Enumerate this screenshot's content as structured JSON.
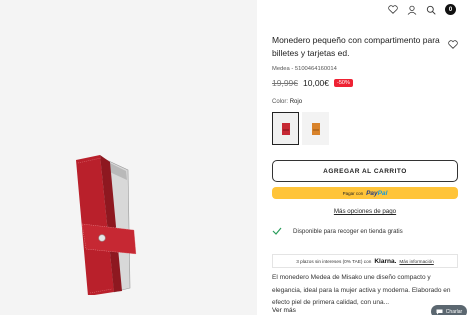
{
  "header": {
    "wishlist_icon": "heart-icon",
    "account_icon": "user-icon",
    "search_icon": "search-icon",
    "cart_count": "0"
  },
  "product": {
    "title": "Monedero pequeño con compartimento para billetes y tarjetas ed.",
    "sku": "Medea - 5100464160014",
    "old_price": "19,99€",
    "price": "10,00€",
    "discount": "-50%",
    "color_label": "Color:",
    "color_value": "Rojo",
    "colors": [
      "#c62833",
      "#d9832b"
    ]
  },
  "actions": {
    "add_to_cart": "AGREGAR AL CARRITO",
    "paypal_prefix": "Pagar con",
    "paypal_brand_1": "Pay",
    "paypal_brand_2": "Pal",
    "more_options": "Más opciones de pago"
  },
  "availability": {
    "text": "Disponible para recoger en tienda gratis"
  },
  "klarna": {
    "text": "3 plazos sin intereses (0% TAE) con",
    "brand": "Klarna.",
    "link": "Más información"
  },
  "description": {
    "text": "El monedero Medea de Misako une diseño compacto y elegancia, ideal para la mujer activa y moderna. Elaborado en efecto piel de primera calidad, con una...",
    "see_more": "Ver más"
  },
  "chat": {
    "label": "Charlar"
  }
}
